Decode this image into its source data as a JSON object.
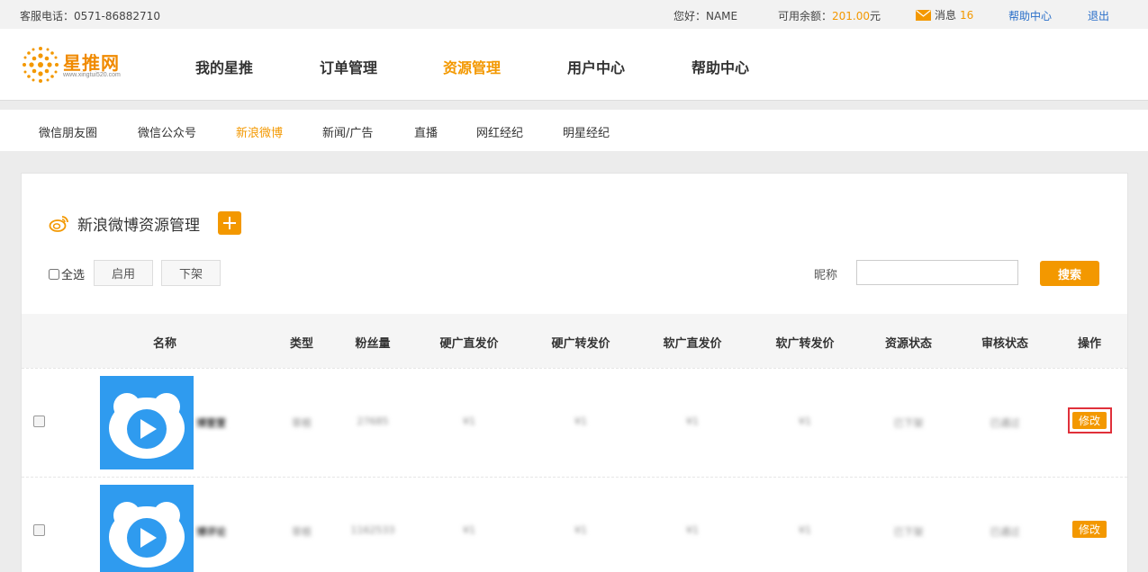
{
  "topbar": {
    "service_phone": "客服电话：0571-86882710",
    "greeting": "您好：NAME",
    "balance_label": "可用余额：",
    "balance_value": "201.00",
    "balance_unit": "元",
    "message_label": "消息",
    "message_count": "16",
    "help_center": "帮助中心",
    "logout": "退出"
  },
  "brand": {
    "name": "星推网",
    "url": "www.xingtui520.com",
    "accent_color": "#f39800"
  },
  "main_nav": [
    {
      "label": "我的星推",
      "active": false
    },
    {
      "label": "订单管理",
      "active": false
    },
    {
      "label": "资源管理",
      "active": true
    },
    {
      "label": "用户中心",
      "active": false
    },
    {
      "label": "帮助中心",
      "active": false
    }
  ],
  "sub_nav": [
    {
      "label": "微信朋友圈",
      "active": false
    },
    {
      "label": "微信公众号",
      "active": false
    },
    {
      "label": "新浪微博",
      "active": true
    },
    {
      "label": "新闻/广告",
      "active": false
    },
    {
      "label": "直播",
      "active": false
    },
    {
      "label": "网红经纪",
      "active": false
    },
    {
      "label": "明星经纪",
      "active": false
    }
  ],
  "panel": {
    "title": "新浪微博资源管理",
    "title_icon": "weibo-icon",
    "add_icon": "plus-icon"
  },
  "toolbar": {
    "select_all": "全选",
    "enable": "启用",
    "offline": "下架",
    "nickname_label": "昵称",
    "nickname_value": "",
    "search": "搜索"
  },
  "table": {
    "columns": [
      "名称",
      "类型",
      "粉丝量",
      "硬广直发价",
      "硬广转发价",
      "软广直发价",
      "软广转发价",
      "资源状态",
      "审核状态",
      "操作"
    ],
    "rows": [
      {
        "name": "博萱萱",
        "type": "草根",
        "fans": "27685",
        "hard_direct": "¥1",
        "hard_forward": "¥1",
        "soft_direct": "¥1",
        "soft_forward": "¥1",
        "resource_status": "已下架",
        "audit_status": "已通过",
        "action": "修改",
        "highlighted": true
      },
      {
        "name": "博评论",
        "type": "草根",
        "fans": "1162533",
        "hard_direct": "¥1",
        "hard_forward": "¥1",
        "soft_direct": "¥1",
        "soft_forward": "¥1",
        "resource_status": "已下架",
        "audit_status": "已通过",
        "action": "修改",
        "highlighted": false
      }
    ]
  }
}
